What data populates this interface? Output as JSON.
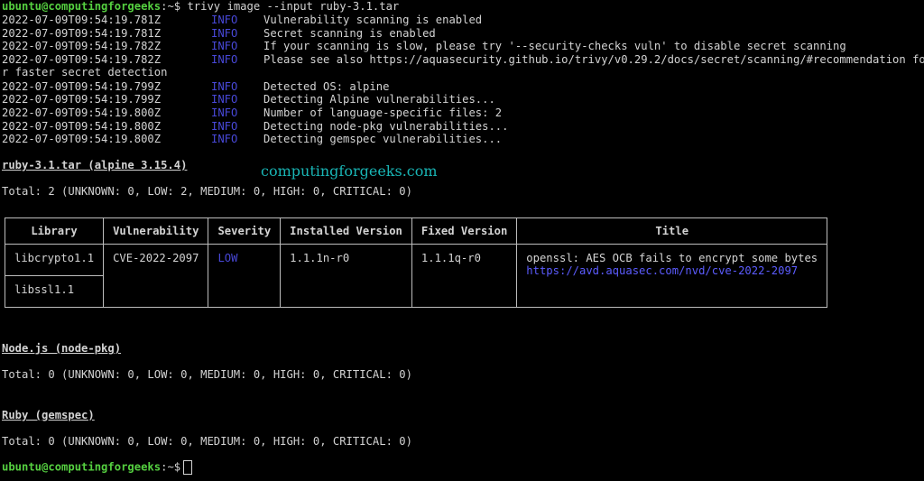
{
  "prompt": {
    "user": "ubuntu@computingforgeeks",
    "path": ":~$",
    "command": " trivy image --input ruby-3.1.tar"
  },
  "logs": [
    {
      "ts": "2022-07-09T09:54:19.781Z",
      "level": "INFO",
      "msg": "Vulnerability scanning is enabled"
    },
    {
      "ts": "2022-07-09T09:54:19.781Z",
      "level": "INFO",
      "msg": "Secret scanning is enabled"
    },
    {
      "ts": "2022-07-09T09:54:19.782Z",
      "level": "INFO",
      "msg": "If your scanning is slow, please try '--security-checks vuln' to disable secret scanning"
    },
    {
      "ts": "2022-07-09T09:54:19.782Z",
      "level": "INFO",
      "msg": "Please see also https://aquasecurity.github.io/trivy/v0.29.2/docs/secret/scanning/#recommendation fo"
    },
    {
      "ts": "2022-07-09T09:54:19.799Z",
      "level": "INFO",
      "msg": "Detected OS: alpine"
    },
    {
      "ts": "2022-07-09T09:54:19.799Z",
      "level": "INFO",
      "msg": "Detecting Alpine vulnerabilities..."
    },
    {
      "ts": "2022-07-09T09:54:19.800Z",
      "level": "INFO",
      "msg": "Number of language-specific files: 2"
    },
    {
      "ts": "2022-07-09T09:54:19.800Z",
      "level": "INFO",
      "msg": "Detecting node-pkg vulnerabilities..."
    },
    {
      "ts": "2022-07-09T09:54:19.800Z",
      "level": "INFO",
      "msg": "Detecting gemspec vulnerabilities..."
    }
  ],
  "wrap": "r faster secret detection",
  "watermark": "computingforgeeks.com",
  "section1": {
    "title": "ruby-3.1.tar (alpine 3.15.4)",
    "total": "Total: 2 (UNKNOWN: 0, LOW: 2, MEDIUM: 0, HIGH: 0, CRITICAL: 0)"
  },
  "table": {
    "headers": [
      "Library",
      "Vulnerability",
      "Severity",
      "Installed Version",
      "Fixed Version",
      "Title"
    ],
    "lib1": "libcrypto1.1",
    "lib2": "libssl1.1",
    "vuln": "CVE-2022-2097",
    "severity": "LOW",
    "installed": "1.1.1n-r0",
    "fixed": "1.1.1q-r0",
    "title": "openssl: AES OCB fails to encrypt some bytes",
    "link": "https://avd.aquasec.com/nvd/cve-2022-2097"
  },
  "section2": {
    "title": "Node.js (node-pkg)",
    "total": "Total: 0 (UNKNOWN: 0, LOW: 0, MEDIUM: 0, HIGH: 0, CRITICAL: 0)"
  },
  "section3": {
    "title": "Ruby (gemspec)",
    "total": "Total: 0 (UNKNOWN: 0, LOW: 0, MEDIUM: 0, HIGH: 0, CRITICAL: 0)"
  },
  "prompt2": {
    "user": "ubuntu@computingforgeeks",
    "path": ":~$"
  },
  "colors": {
    "prompt": "#55d040",
    "info": "#4848d8",
    "watermark": "#19b5b5"
  }
}
